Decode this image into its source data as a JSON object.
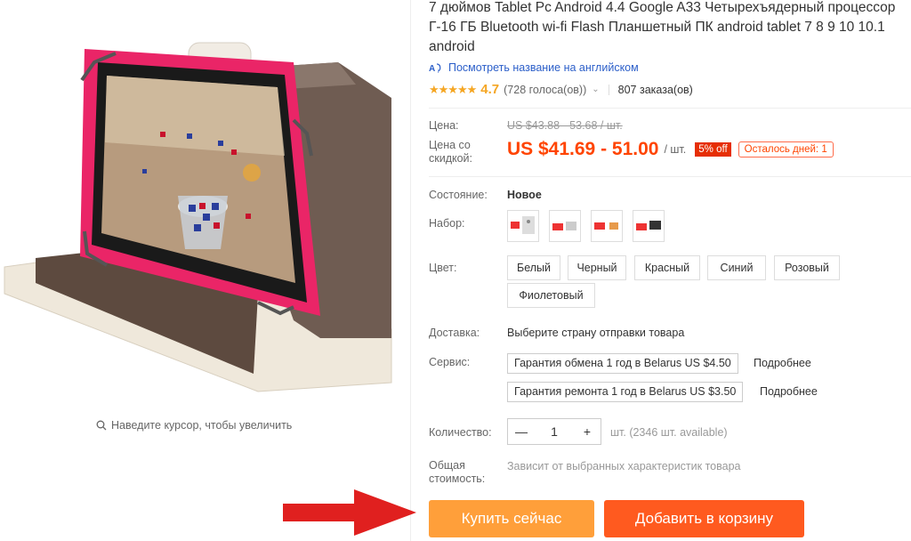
{
  "product": {
    "title": "7 дюймов Tablet Pc Android 4.4 Google A33 Четырехъядерный процессор Г-16 ГБ Bluetooth wi-fi Flash Планшетный ПК android tablet 7 8 9 10 10.1 android",
    "translate_link": "Посмотреть название на английском",
    "rating_value": "4.7",
    "rating_stars": 4.7,
    "votes": "(728 голоса(ов))",
    "orders": "807 заказа(ов)",
    "zoom_hint": "Наведите курсор, чтобы увеличить"
  },
  "price": {
    "label": "Цена:",
    "old": "US $43.88 - 53.68 / шт.",
    "discount_label": "Цена со скидкой:",
    "new": "US $41.69 - 51.00",
    "unit": "/ шт.",
    "badge": "5% off",
    "days_left": "Осталось дней: 1"
  },
  "options": {
    "condition_label": "Состояние:",
    "condition_value": "Новое",
    "set_label": "Набор:",
    "color_label": "Цвет:",
    "colors": [
      "Белый",
      "Черный",
      "Красный",
      "Синий",
      "Розовый",
      "Фиолетовый"
    ],
    "delivery_label": "Доставка:",
    "delivery_value": "Выберите страну отправки товара",
    "service_label": "Сервис:",
    "services": [
      {
        "text": "Гарантия обмена 1 год в Belarus US $4.50",
        "more": "Подробнее"
      },
      {
        "text": "Гарантия ремонта 1 год в Belarus US $3.50",
        "more": "Подробнее"
      }
    ],
    "qty_label": "Количество:",
    "qty_value": "1",
    "qty_minus": "—",
    "qty_plus": "+",
    "qty_note": "шт. (2346 шт. available)",
    "total_label": "Общая стоимость:",
    "total_value": "Зависит от выбранных характеристик товара"
  },
  "buttons": {
    "buy": "Купить сейчас",
    "cart": "Добавить в корзину"
  },
  "colors": {
    "accent": "#ff4400",
    "buy_button": "#ff9f3a",
    "cart_button": "#ff5a1f",
    "link": "#2c5fc9",
    "star": "#f5a623",
    "arrow": "#e0201f"
  }
}
